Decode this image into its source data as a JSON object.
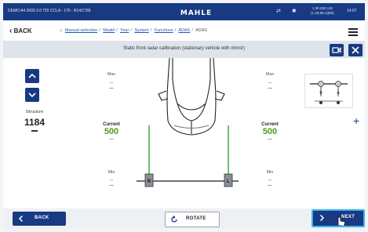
{
  "status": {
    "vehicle": "DEMO A4 2009 3.0 TDI CCLA - 176 - B14/1786",
    "brand": "MAHLE",
    "ip_line1": "1.30.282.115",
    "ip_line2": "(1,30,86,1)(80)",
    "time": "14:07"
  },
  "breadcrumb": {
    "back_label": "BACK",
    "items": [
      "Manual selection",
      "Model",
      "Year",
      "System",
      "Functions",
      "ADAS"
    ],
    "current": "ADAS"
  },
  "title": "Static front radar calibration (stationary vehicle with mirror)",
  "left": {
    "structure_label": "Structure",
    "structure_value": "1184",
    "structure_dash": "—"
  },
  "left_col": {
    "max_label": "Max",
    "max_value": "--",
    "max_dash": "—",
    "current_label": "Current",
    "current_value": "500",
    "current_dash": "—",
    "min_label": "Min",
    "min_value": "--",
    "min_dash": "—"
  },
  "right_col": {
    "max_label": "Max",
    "max_value": "--",
    "max_dash": "—",
    "current_label": "Current",
    "current_value": "500",
    "current_dash": "—",
    "min_label": "Min",
    "min_value": "--",
    "min_dash": "—"
  },
  "diagram": {
    "sensor_left": "R",
    "sensor_right": "L",
    "thumb_left": "B",
    "thumb_right": "A"
  },
  "footer": {
    "back_label": "BACK",
    "rotate_label": "ROTATE",
    "next_label": "NEXT"
  },
  "colors": {
    "primary": "#173a82",
    "accent_green": "#4a9e1f",
    "highlight": "#3bb4ea"
  }
}
